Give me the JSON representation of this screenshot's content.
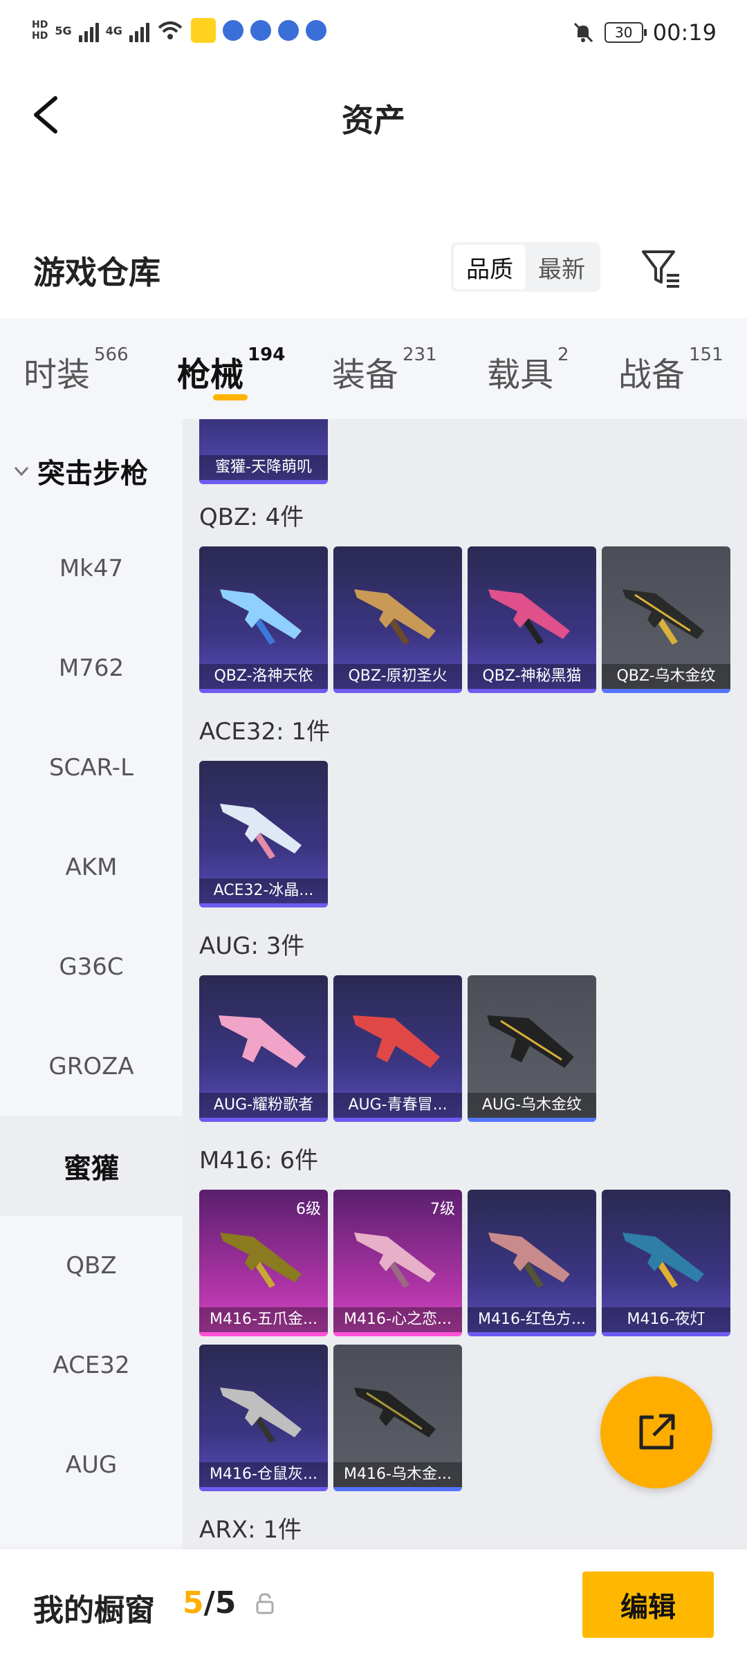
{
  "status_bar": {
    "hd1": "HD",
    "hd2": "HD",
    "net1": "5G",
    "net2": "4G",
    "battery": "30",
    "time": "00:19"
  },
  "header": {
    "title": "资产"
  },
  "warehouse": {
    "title": "游戏仓库",
    "sort_quality": "品质",
    "sort_latest": "最新"
  },
  "tabs": [
    {
      "label": "时装",
      "count": "566"
    },
    {
      "label": "枪械",
      "count": "194"
    },
    {
      "label": "装备",
      "count": "231"
    },
    {
      "label": "载具",
      "count": "2"
    },
    {
      "label": "战备",
      "count": "151"
    }
  ],
  "sidebar": {
    "category": "突击步枪",
    "items": [
      "Mk47",
      "M762",
      "SCAR-L",
      "AKM",
      "G36C",
      "GROZA",
      "蜜獾",
      "QBZ",
      "ACE32",
      "AUG"
    ]
  },
  "content": {
    "top_card": "蜜獾-天降萌叽",
    "groups": [
      {
        "title": "QBZ: 4件",
        "items": [
          "QBZ-洛神天依",
          "QBZ-原初圣火",
          "QBZ-神秘黑猫",
          "QBZ-乌木金纹"
        ]
      },
      {
        "title": "ACE32: 1件",
        "items": [
          "ACE32-冰晶..."
        ]
      },
      {
        "title": "AUG: 3件",
        "items": [
          "AUG-耀粉歌者",
          "AUG-青春冒...",
          "AUG-乌木金纹"
        ]
      },
      {
        "title": "M416: 6件",
        "items": [
          "M416-五爪金...",
          "M416-心之恋...",
          "M416-红色方...",
          "M416-夜灯",
          "M416-仓鼠灰...",
          "M416-乌木金..."
        ],
        "levels": [
          "6级",
          "7级"
        ]
      },
      {
        "title": "ARX: 1件"
      }
    ]
  },
  "bottom": {
    "title": "我的橱窗",
    "count_current": "5",
    "count_sep": "/",
    "count_total": "5",
    "edit": "编辑"
  },
  "colors": {
    "accent": "#ffae00",
    "edit_button": "#ffb800",
    "card_purple": "#3b3582",
    "card_gray": "#5d6068",
    "card_pink": "#b235a8"
  }
}
